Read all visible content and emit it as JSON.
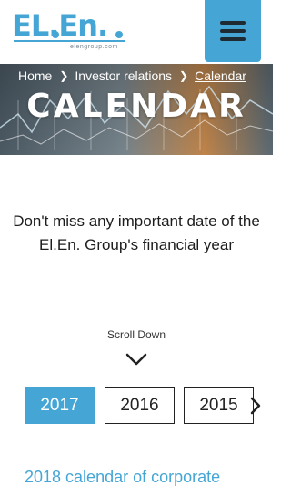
{
  "brand": {
    "logo_text": "EL.En.",
    "domain": "elengroup.com",
    "accent": "#45a6d5"
  },
  "header": {
    "menu_icon": "hamburger-icon"
  },
  "breadcrumb": {
    "items": [
      "Home",
      "Investor relations",
      "Calendar"
    ],
    "separator_icon": "chevron-right-icon"
  },
  "hero": {
    "title": "CALENDAR"
  },
  "intro": {
    "text": "Don't miss any important date of the El.En. Group's financial year"
  },
  "scroll": {
    "label": "Scroll Down",
    "icon": "chevron-down-icon"
  },
  "years": {
    "items": [
      "2017",
      "2016",
      "2015"
    ],
    "selected": "2017",
    "next_icon": "chevron-right-icon"
  },
  "section": {
    "title": "2018 calendar of corporate"
  }
}
